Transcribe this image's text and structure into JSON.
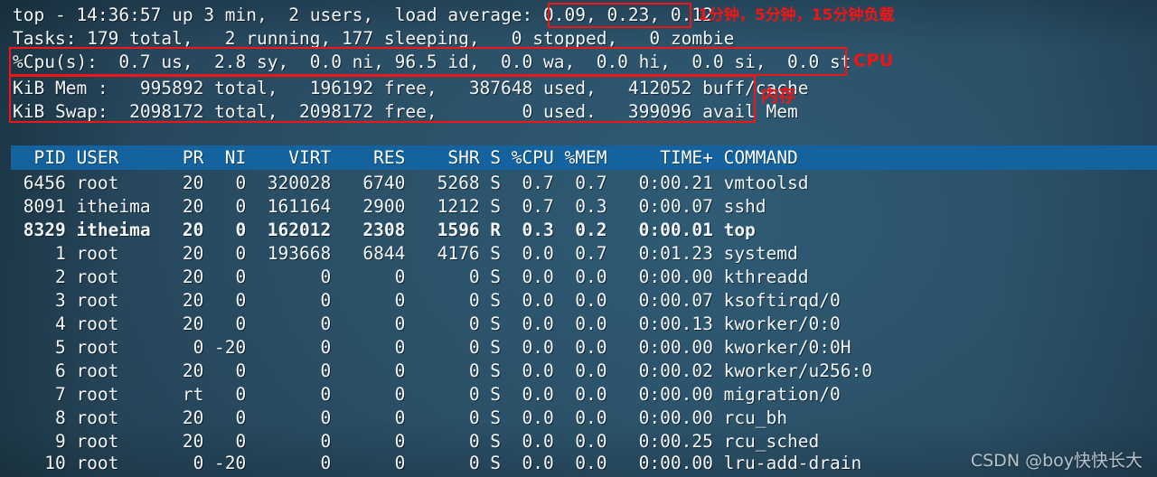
{
  "terminal": {
    "summary": {
      "uptime_line": "top - 14:36:57 up 3 min,  2 users,  load average: 0.09, 0.23, 0.12",
      "tasks_line": "Tasks: 179 total,   2 running, 177 sleeping,   0 stopped,   0 zombie",
      "cpu_line": "%Cpu(s):  0.7 us,  2.8 sy,  0.0 ni, 96.5 id,  0.0 wa,  0.0 hi,  0.0 si,  0.0 st",
      "mem_line": "KiB Mem :   995892 total,   196192 free,   387648 used,   412052 buff/cache",
      "swap_line": "KiB Swap:  2098172 total,  2098172 free,        0 used.   399096 avail Mem",
      "fields": {
        "time": "14:36:57",
        "uptime": "3 min",
        "users": "2",
        "load_1min": "0.09",
        "load_5min": "0.23",
        "load_15min": "0.12",
        "tasks_total": "179",
        "tasks_running": "2",
        "tasks_sleeping": "177",
        "tasks_stopped": "0",
        "tasks_zombie": "0",
        "cpu_us": "0.7",
        "cpu_sy": "2.8",
        "cpu_ni": "0.0",
        "cpu_id": "96.5",
        "cpu_wa": "0.0",
        "cpu_hi": "0.0",
        "cpu_si": "0.0",
        "cpu_st": "0.0",
        "mem_total": "995892",
        "mem_free": "196192",
        "mem_used": "387648",
        "mem_buff_cache": "412052",
        "swap_total": "2098172",
        "swap_free": "2098172",
        "swap_used": "0",
        "swap_avail_mem": "399096"
      }
    },
    "table": {
      "header_line": "  PID USER      PR  NI    VIRT    RES    SHR S %CPU %MEM     TIME+ COMMAND",
      "columns": [
        "PID",
        "USER",
        "PR",
        "NI",
        "VIRT",
        "RES",
        "SHR",
        "S",
        "%CPU",
        "%MEM",
        "TIME+",
        "COMMAND"
      ],
      "rows": [
        {
          "line": " 6456 root      20   0  320028   6740   5268 S  0.7  0.7   0:00.21 vmtoolsd",
          "pid": "6456",
          "user": "root",
          "pr": "20",
          "ni": "0",
          "virt": "320028",
          "res": "6740",
          "shr": "5268",
          "s": "S",
          "cpu": "0.7",
          "mem": "0.7",
          "time": "0:00.21",
          "command": "vmtoolsd",
          "bold": false
        },
        {
          "line": " 8091 itheima   20   0  161164   2900   1212 S  0.7  0.3   0:00.07 sshd",
          "pid": "8091",
          "user": "itheima",
          "pr": "20",
          "ni": "0",
          "virt": "161164",
          "res": "2900",
          "shr": "1212",
          "s": "S",
          "cpu": "0.7",
          "mem": "0.3",
          "time": "0:00.07",
          "command": "sshd",
          "bold": false
        },
        {
          "line": " 8329 itheima   20   0  162012   2308   1596 R  0.3  0.2   0:00.01 top",
          "pid": "8329",
          "user": "itheima",
          "pr": "20",
          "ni": "0",
          "virt": "162012",
          "res": "2308",
          "shr": "1596",
          "s": "R",
          "cpu": "0.3",
          "mem": "0.2",
          "time": "0:00.01",
          "command": "top",
          "bold": true
        },
        {
          "line": "    1 root      20   0  193668   6844   4176 S  0.0  0.7   0:01.23 systemd",
          "pid": "1",
          "user": "root",
          "pr": "20",
          "ni": "0",
          "virt": "193668",
          "res": "6844",
          "shr": "4176",
          "s": "S",
          "cpu": "0.0",
          "mem": "0.7",
          "time": "0:01.23",
          "command": "systemd",
          "bold": false
        },
        {
          "line": "    2 root      20   0       0      0      0 S  0.0  0.0   0:00.00 kthreadd",
          "pid": "2",
          "user": "root",
          "pr": "20",
          "ni": "0",
          "virt": "0",
          "res": "0",
          "shr": "0",
          "s": "S",
          "cpu": "0.0",
          "mem": "0.0",
          "time": "0:00.00",
          "command": "kthreadd",
          "bold": false
        },
        {
          "line": "    3 root      20   0       0      0      0 S  0.0  0.0   0:00.07 ksoftirqd/0",
          "pid": "3",
          "user": "root",
          "pr": "20",
          "ni": "0",
          "virt": "0",
          "res": "0",
          "shr": "0",
          "s": "S",
          "cpu": "0.0",
          "mem": "0.0",
          "time": "0:00.07",
          "command": "ksoftirqd/0",
          "bold": false
        },
        {
          "line": "    4 root      20   0       0      0      0 S  0.0  0.0   0:00.13 kworker/0:0",
          "pid": "4",
          "user": "root",
          "pr": "20",
          "ni": "0",
          "virt": "0",
          "res": "0",
          "shr": "0",
          "s": "S",
          "cpu": "0.0",
          "mem": "0.0",
          "time": "0:00.13",
          "command": "kworker/0:0",
          "bold": false
        },
        {
          "line": "    5 root       0 -20       0      0      0 S  0.0  0.0   0:00.00 kworker/0:0H",
          "pid": "5",
          "user": "root",
          "pr": "0",
          "ni": "-20",
          "virt": "0",
          "res": "0",
          "shr": "0",
          "s": "S",
          "cpu": "0.0",
          "mem": "0.0",
          "time": "0:00.00",
          "command": "kworker/0:0H",
          "bold": false
        },
        {
          "line": "    6 root      20   0       0      0      0 S  0.0  0.0   0:00.02 kworker/u256:0",
          "pid": "6",
          "user": "root",
          "pr": "20",
          "ni": "0",
          "virt": "0",
          "res": "0",
          "shr": "0",
          "s": "S",
          "cpu": "0.0",
          "mem": "0.0",
          "time": "0:00.02",
          "command": "kworker/u256:0",
          "bold": false
        },
        {
          "line": "    7 root      rt   0       0      0      0 S  0.0  0.0   0:00.00 migration/0",
          "pid": "7",
          "user": "root",
          "pr": "rt",
          "ni": "0",
          "virt": "0",
          "res": "0",
          "shr": "0",
          "s": "S",
          "cpu": "0.0",
          "mem": "0.0",
          "time": "0:00.00",
          "command": "migration/0",
          "bold": false
        },
        {
          "line": "    8 root      20   0       0      0      0 S  0.0  0.0   0:00.00 rcu_bh",
          "pid": "8",
          "user": "root",
          "pr": "20",
          "ni": "0",
          "virt": "0",
          "res": "0",
          "shr": "0",
          "s": "S",
          "cpu": "0.0",
          "mem": "0.0",
          "time": "0:00.00",
          "command": "rcu_bh",
          "bold": false
        },
        {
          "line": "    9 root      20   0       0      0      0 S  0.0  0.0   0:00.25 rcu_sched",
          "pid": "9",
          "user": "root",
          "pr": "20",
          "ni": "0",
          "virt": "0",
          "res": "0",
          "shr": "0",
          "s": "S",
          "cpu": "0.0",
          "mem": "0.0",
          "time": "0:00.25",
          "command": "rcu_sched",
          "bold": false
        },
        {
          "line": "   10 root       0 -20       0      0      0 S  0.0  0.0   0:00.00 lru-add-drain",
          "pid": "10",
          "user": "root",
          "pr": "0",
          "ni": "-20",
          "virt": "0",
          "res": "0",
          "shr": "0",
          "s": "S",
          "cpu": "0.0",
          "mem": "0.0",
          "time": "0:00.00",
          "command": "lru-add-drain",
          "bold": false
        }
      ]
    }
  },
  "annotations": {
    "color": "#f31414",
    "load_label": "1分钟，5分钟，15分钟负载",
    "cpu_label": "CPU",
    "mem_label": "内存"
  },
  "watermark": {
    "text": "CSDN @boy快快长大"
  }
}
